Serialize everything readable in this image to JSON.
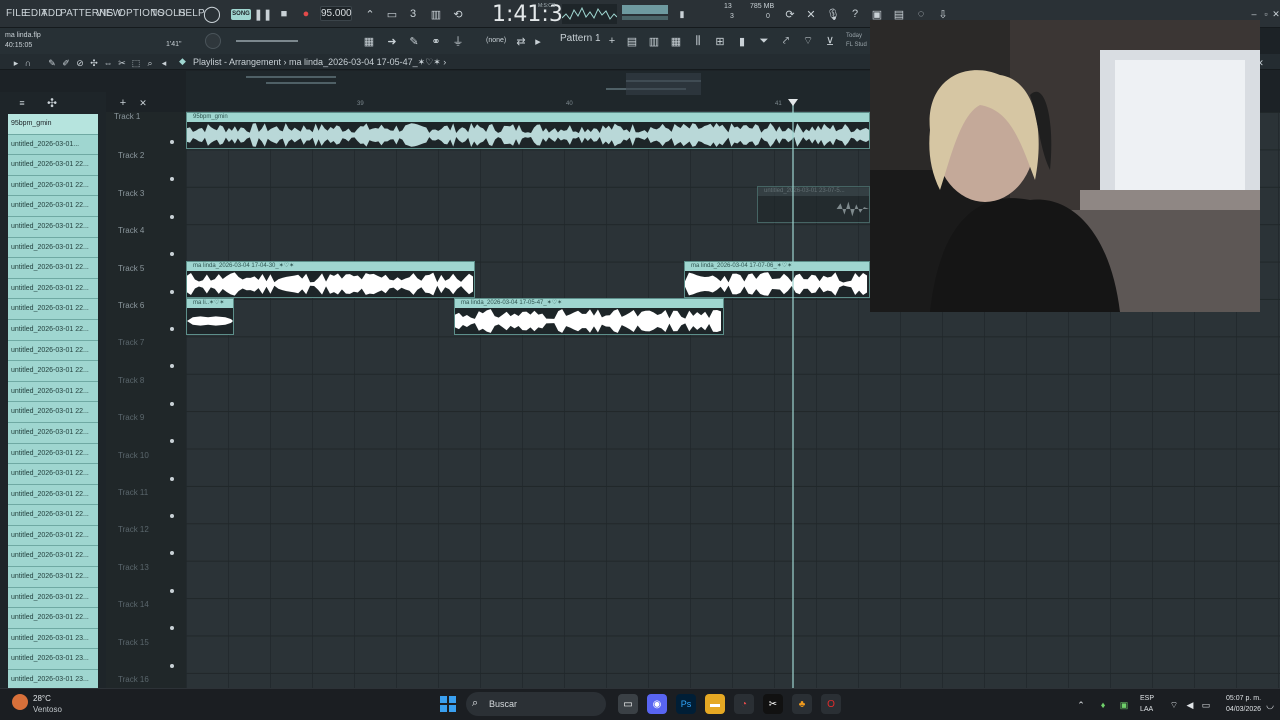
{
  "menu": [
    "FILE",
    "EDIT",
    "ADD",
    "PATTERNS",
    "VIEW",
    "OPTIONS",
    "TOOLS",
    "HELP"
  ],
  "transport": {
    "song_badge": "SONG",
    "tempo": "95.000",
    "time": "1:41:30",
    "time_unit": "M:S:CS",
    "cpu": "13",
    "cpu_sub": "3",
    "memory": "785 MB",
    "memory_sub": "0"
  },
  "project": {
    "filename": "ma linda.flp",
    "elapsed": "40:15:05",
    "hint_time": "1'41\""
  },
  "toolbar": {
    "none_label": "(none)",
    "pattern": "Pattern 1",
    "today_line1": "Today",
    "today_line2": "FL Stud"
  },
  "playlist": {
    "title": "Playlist - Arrangement",
    "current_clip": "ma linda_2026-03-04 17-05-47_✶♡✶"
  },
  "browser": {
    "items": [
      "95bpm_gmin",
      "untitled_2026-03-01...",
      "untitled_2026-03-01 22...",
      "untitled_2026-03-01 22...",
      "untitled_2026-03-01 22...",
      "untitled_2026-03-01 22...",
      "untitled_2026-03-01 22...",
      "untitled_2026-03-01 22...",
      "untitled_2026-03-01 22...",
      "untitled_2026-03-01 22...",
      "untitled_2026-03-01 22...",
      "untitled_2026-03-01 22...",
      "untitled_2026-03-01 22...",
      "untitled_2026-03-01 22...",
      "untitled_2026-03-01 22...",
      "untitled_2026-03-01 22...",
      "untitled_2026-03-01 22...",
      "untitled_2026-03-01 22...",
      "untitled_2026-03-01 22...",
      "untitled_2026-03-01 22...",
      "untitled_2026-03-01 22...",
      "untitled_2026-03-01 22...",
      "untitled_2026-03-01 22...",
      "untitled_2026-03-01 22...",
      "untitled_2026-03-01 22...",
      "untitled_2026-03-01 23...",
      "untitled_2026-03-01 23...",
      "untitled_2026-03-01 23..."
    ]
  },
  "tracks": [
    "Track 1",
    "Track 2",
    "Track 3",
    "Track 4",
    "Track 5",
    "Track 6",
    "Track 7",
    "Track 8",
    "Track 9",
    "Track 10",
    "Track 11",
    "Track 12",
    "Track 13",
    "Track 14",
    "Track 15",
    "Track 16"
  ],
  "ruler": [
    "39",
    "40",
    "41"
  ],
  "clips": {
    "track1": "95bpm_gmin",
    "track3": "untitled_2026-03-01 23-07-5...",
    "track5a": "ma linda_2026-03-04 17-04-30_✶♡✶",
    "track5b": "ma linda_2026-03-04 17-07-06_✶♡✶",
    "track6a": "ma li..✶♡✶",
    "track6b": "ma linda_2026-03-04 17-05-47_✶♡✶"
  },
  "taskbar": {
    "temperature": "28°C",
    "weather": "Ventoso",
    "search": "Buscar",
    "lang1": "ESP",
    "lang2": "LAA",
    "clock_time": "05:07 p. m.",
    "clock_date": "04/03/2026"
  },
  "colors": {
    "accent": "#9fd6d0",
    "background": "#1c2226",
    "grid": "#2b3337"
  }
}
